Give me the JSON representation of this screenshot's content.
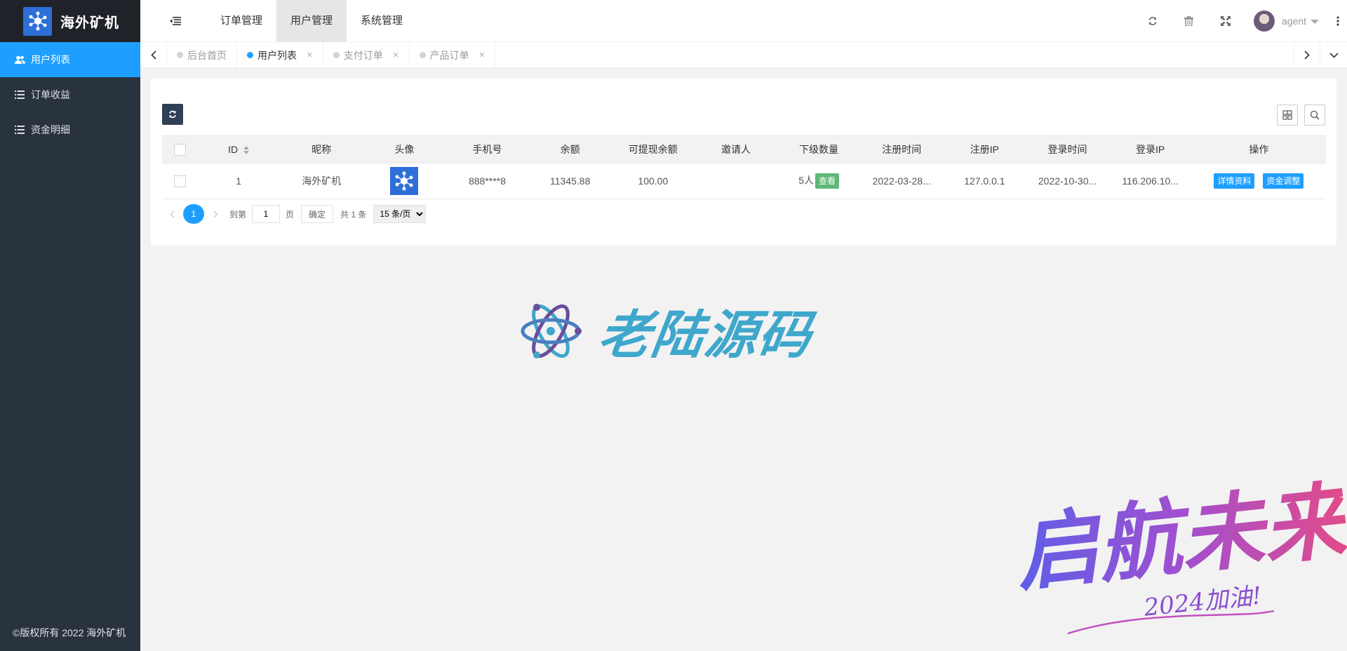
{
  "app": {
    "name": "海外矿机",
    "copyright": "©版权所有 2022 海外矿机"
  },
  "sidebar": {
    "items": [
      {
        "label": "用户列表",
        "icon": "users-icon",
        "active": true
      },
      {
        "label": "订单收益",
        "icon": "list-icon",
        "active": false
      },
      {
        "label": "资金明细",
        "icon": "list-icon",
        "active": false
      }
    ]
  },
  "header": {
    "nav": [
      {
        "label": "订单管理",
        "active": false
      },
      {
        "label": "用户管理",
        "active": true
      },
      {
        "label": "系统管理",
        "active": false
      }
    ],
    "username": "agent"
  },
  "tabs": [
    {
      "label": "后台首页",
      "active": false,
      "closable": false
    },
    {
      "label": "用户列表",
      "active": true,
      "closable": true
    },
    {
      "label": "支付订单",
      "active": false,
      "closable": true
    },
    {
      "label": "产品订单",
      "active": false,
      "closable": true
    }
  ],
  "table": {
    "columns": [
      "ID",
      "昵称",
      "头像",
      "手机号",
      "余额",
      "可提现余额",
      "邀请人",
      "下级数量",
      "注册时间",
      "注册IP",
      "登录时间",
      "登录IP",
      "操作"
    ],
    "rows": [
      {
        "id": "1",
        "nickname": "海外矿机",
        "phone": "888****8",
        "balance": "11345.88",
        "withdrawable": "100.00",
        "inviter": "",
        "subordinates": "5人",
        "view_label": "查看",
        "reg_time": "2022-03-28...",
        "reg_ip": "127.0.0.1",
        "login_time": "2022-10-30...",
        "login_ip": "116.206.10...",
        "action_detail": "详情资料",
        "action_funds": "资金调整"
      }
    ]
  },
  "pager": {
    "current": "1",
    "goto_label": "到第",
    "page_value": "1",
    "page_unit": "页",
    "confirm_label": "确定",
    "total": "共 1 条",
    "page_size": "15 条/页"
  },
  "watermarks": {
    "brand": "老陆源码",
    "slogan": "启航未来",
    "slogan_sub": "2024加油!"
  },
  "colors": {
    "accent": "#1e9fff",
    "sidebar": "#28333e",
    "green": "#5fb878"
  }
}
